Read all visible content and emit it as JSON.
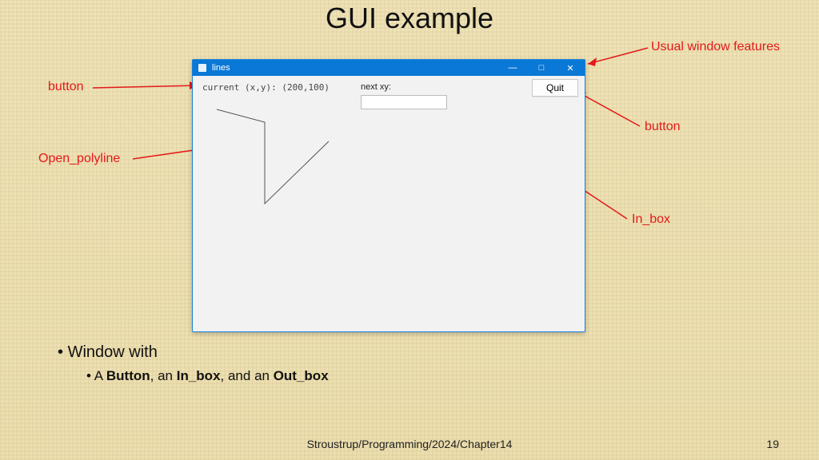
{
  "slide": {
    "title": "GUI example",
    "footer": "Stroustrup/Programming/2024/Chapter14",
    "page": "19"
  },
  "window": {
    "title": "lines",
    "current_label": "current (x,y): (200,100)",
    "next_label": "next xy:",
    "next_value": "",
    "quit_label": "Quit",
    "minimize_glyph": "—",
    "maximize_glyph": "□",
    "close_glyph": "✕"
  },
  "annotations": {
    "window_features": "Usual window features",
    "button_left": "button",
    "button_right": "button",
    "open_polyline": "Open_polyline",
    "in_box": "In_box"
  },
  "bullets": {
    "line1": "Window with",
    "line2_prefix": "A ",
    "b1": "Button",
    "sep1": ", an ",
    "b2": "In_box",
    "sep2": ", and an ",
    "b3": "Out_box"
  }
}
